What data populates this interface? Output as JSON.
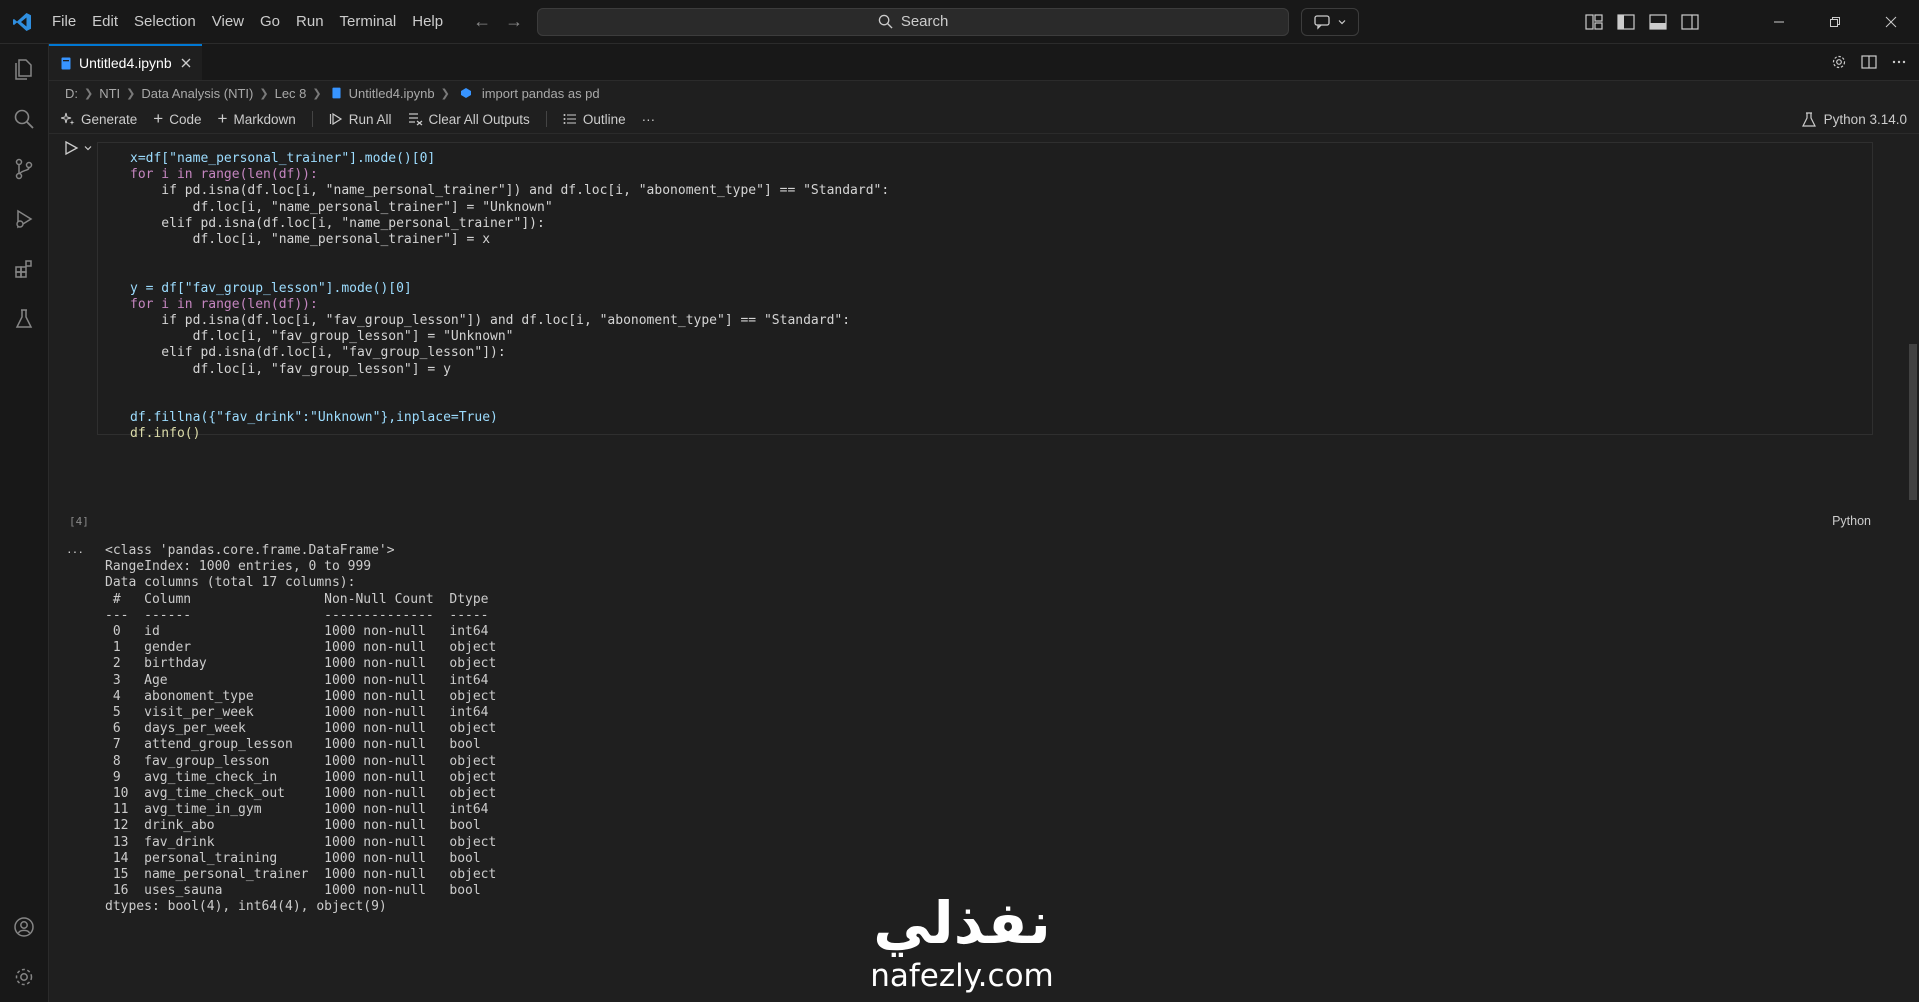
{
  "menu": [
    "File",
    "Edit",
    "Selection",
    "View",
    "Go",
    "Run",
    "Terminal",
    "Help"
  ],
  "search": {
    "label": "Search"
  },
  "tab": {
    "title": "Untitled4.ipynb"
  },
  "breadcrumb": [
    "D:",
    "NTI",
    "Data Analysis (NTI)",
    "Lec 8",
    "Untitled4.ipynb",
    "import pandas as pd"
  ],
  "toolbar": {
    "generate": "Generate",
    "code": "Code",
    "markdown": "Markdown",
    "run_all": "Run All",
    "clear_outputs": "Clear All Outputs",
    "outline": "Outline",
    "more": "···",
    "kernel": "Python 3.14.0"
  },
  "cell": {
    "execution_count": "[4]",
    "language": "Python",
    "code_lines": [
      "x=df[\"name_personal_trainer\"].mode()[0]",
      "for i in range(len(df)):",
      "    if pd.isna(df.loc[i, \"name_personal_trainer\"]) and df.loc[i, \"abonoment_type\"] == \"Standard\":",
      "        df.loc[i, \"name_personal_trainer\"] = \"Unknown\"",
      "    elif pd.isna(df.loc[i, \"name_personal_trainer\"]):",
      "        df.loc[i, \"name_personal_trainer\"] = x",
      "",
      "",
      "y = df[\"fav_group_lesson\"].mode()[0]",
      "for i in range(len(df)):",
      "    if pd.isna(df.loc[i, \"fav_group_lesson\"]) and df.loc[i, \"abonoment_type\"] == \"Standard\":",
      "        df.loc[i, \"fav_group_lesson\"] = \"Unknown\"",
      "    elif pd.isna(df.loc[i, \"fav_group_lesson\"]):",
      "        df.loc[i, \"fav_group_lesson\"] = y",
      "",
      "",
      "df.fillna({\"fav_drink\":\"Unknown\"},inplace=True)",
      "df.info()"
    ]
  },
  "output": {
    "more": "···",
    "lines": [
      "<class 'pandas.core.frame.DataFrame'>",
      "RangeIndex: 1000 entries, 0 to 999",
      "Data columns (total 17 columns):",
      " #   Column                 Non-Null Count  Dtype ",
      "---  ------                 --------------  ----- ",
      " 0   id                     1000 non-null   int64 ",
      " 1   gender                 1000 non-null   object",
      " 2   birthday               1000 non-null   object",
      " 3   Age                    1000 non-null   int64 ",
      " 4   abonoment_type         1000 non-null   object",
      " 5   visit_per_week         1000 non-null   int64 ",
      " 6   days_per_week          1000 non-null   object",
      " 7   attend_group_lesson    1000 non-null   bool  ",
      " 8   fav_group_lesson       1000 non-null   object",
      " 9   avg_time_check_in      1000 non-null   object",
      " 10  avg_time_check_out     1000 non-null   object",
      " 11  avg_time_in_gym        1000 non-null   int64 ",
      " 12  drink_abo              1000 non-null   bool  ",
      " 13  fav_drink              1000 non-null   object",
      " 14  personal_training      1000 non-null   bool  ",
      " 15  name_personal_trainer  1000 non-null   object",
      " 16  uses_sauna             1000 non-null   bool  ",
      "dtypes: bool(4), int64(4), object(9)"
    ]
  },
  "watermark": {
    "arabic": "نفذلي",
    "latin": "nafezly.com"
  },
  "colors": {
    "accent": "#0078d4",
    "background": "#1f1f1f",
    "chrome": "#181818"
  }
}
